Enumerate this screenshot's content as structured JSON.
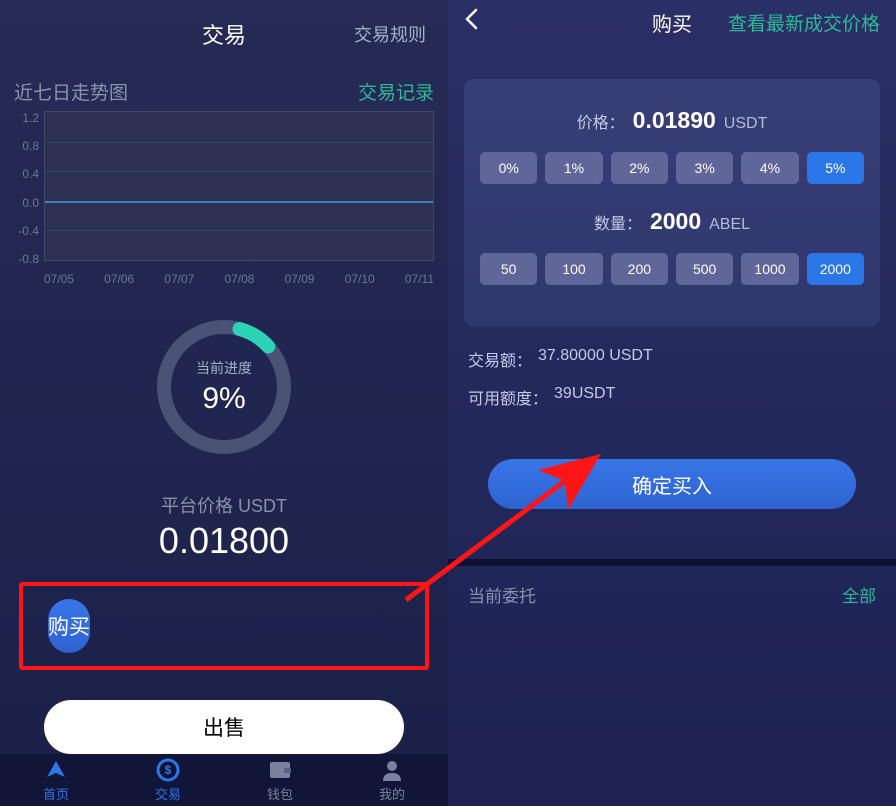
{
  "left": {
    "header": {
      "title": "交易",
      "rules_link": "交易规则"
    },
    "chart": {
      "title": "近七日走势图",
      "link": "交易记录",
      "y_ticks": [
        "1.2",
        "0.8",
        "0.4",
        "0.0",
        "-0.4",
        "-0.8"
      ],
      "x_ticks": [
        "07/05",
        "07/06",
        "07/07",
        "07/08",
        "07/09",
        "07/10",
        "07/11"
      ]
    },
    "progress": {
      "label": "当前进度",
      "value": "9%"
    },
    "price": {
      "label": "平台价格 USDT",
      "value": "0.01800"
    },
    "buttons": {
      "buy": "购买",
      "sell": "出售"
    },
    "nav": {
      "home": "首页",
      "trade": "交易",
      "wallet": "钱包",
      "mine": "我的"
    }
  },
  "right": {
    "header": {
      "title": "购买",
      "link": "查看最新成交价格"
    },
    "price": {
      "label": "价格：",
      "value": "0.01890",
      "unit": "USDT"
    },
    "pct_options": [
      "0%",
      "1%",
      "2%",
      "3%",
      "4%",
      "5%"
    ],
    "pct_selected": "5%",
    "qty": {
      "label": "数量：",
      "value": "2000",
      "unit": "ABEL"
    },
    "qty_options": [
      "50",
      "100",
      "200",
      "500",
      "1000",
      "2000"
    ],
    "qty_selected": "2000",
    "info": {
      "amount_label": "交易额：",
      "amount_value": "37.80000 USDT",
      "avail_label": "可用额度：",
      "avail_value": "39USDT"
    },
    "confirm": "确定买入",
    "orders": {
      "label": "当前委托",
      "all_link": "全部"
    }
  },
  "chart_data": {
    "type": "line",
    "title": "近七日走势图",
    "x": [
      "07/05",
      "07/06",
      "07/07",
      "07/08",
      "07/09",
      "07/10",
      "07/11"
    ],
    "values": [
      0.0,
      0.0,
      0.0,
      0.0,
      0.0,
      0.0,
      0.0
    ],
    "ylabel": "",
    "xlabel": "",
    "ylim": [
      -0.8,
      1.2
    ]
  }
}
